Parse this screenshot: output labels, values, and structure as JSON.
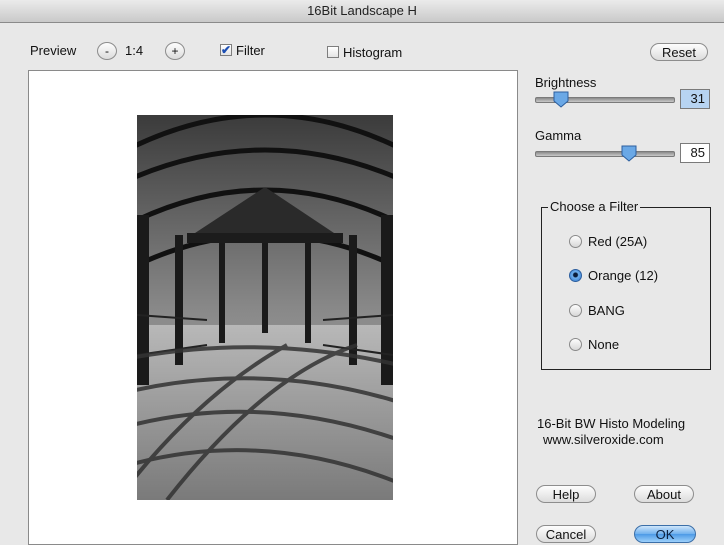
{
  "window": {
    "title": "16Bit Landscape H"
  },
  "toolbar": {
    "preview_label": "Preview",
    "zoom_minus": "-",
    "zoom_level": "1:4",
    "zoom_plus": "+",
    "filter_label": "Filter",
    "filter_checked": true,
    "histogram_label": "Histogram",
    "histogram_checked": false,
    "reset_label": "Reset"
  },
  "controls": {
    "brightness": {
      "label": "Brightness",
      "value": "31",
      "level": 0.31
    },
    "gamma": {
      "label": "Gamma",
      "value": "85",
      "level": 0.66
    }
  },
  "filter_group": {
    "title": "Choose a Filter",
    "options": [
      {
        "label": "Red (25A)",
        "selected": false
      },
      {
        "label": "Orange (12)",
        "selected": true
      },
      {
        "label": "BANG",
        "selected": false
      },
      {
        "label": "None",
        "selected": false
      }
    ]
  },
  "info": {
    "line1": "16-Bit BW Histo Modeling",
    "line2": "www.silveroxide.com"
  },
  "buttons": {
    "help": "Help",
    "about": "About",
    "cancel": "Cancel",
    "ok": "OK"
  },
  "colors": {
    "default_button": "#4d9ae6"
  }
}
